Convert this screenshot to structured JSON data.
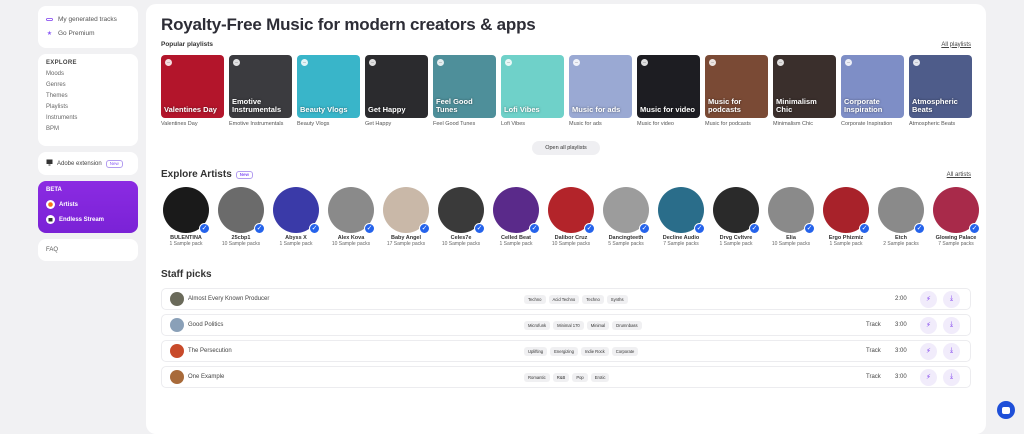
{
  "sidebar": {
    "generated": "My generated tracks",
    "premium": "Go Premium",
    "explore_title": "EXPLORE",
    "explore_items": [
      "Moods",
      "Genres",
      "Themes",
      "Playlists",
      "Instruments",
      "BPM"
    ],
    "extension": "Adobe extension",
    "new_badge": "New",
    "beta_title": "BETA",
    "beta_items": [
      "Artists",
      "Endless Stream"
    ],
    "faq": "FAQ"
  },
  "main": {
    "title": "Royalty-Free Music for modern creators & apps",
    "popular_title": "Popular playlists",
    "all_playlists": "All playlists",
    "open_all": "Open all playlists",
    "playlists": [
      {
        "label": "Valentines Day",
        "caption": "Valentines Day",
        "color": "#b3152b"
      },
      {
        "label": "Emotive Instrumentals",
        "caption": "Emotive Instrumentals",
        "color": "#3b3b3f"
      },
      {
        "label": "Beauty Vlogs",
        "caption": "Beauty Vlogs",
        "color": "#39b5c9"
      },
      {
        "label": "Get Happy",
        "caption": "Get Happy",
        "color": "#2b2b2e"
      },
      {
        "label": "Feel Good Tunes",
        "caption": "Feel Good Tunes",
        "color": "#4e8f9a"
      },
      {
        "label": "Lofi Vibes",
        "caption": "Lofi Vibes",
        "color": "#6fd1c9"
      },
      {
        "label": "Music for ads",
        "caption": "Music for ads",
        "color": "#9aa9d3"
      },
      {
        "label": "Music for video",
        "caption": "Music for video",
        "color": "#1d1d22"
      },
      {
        "label": "Music for podcasts",
        "caption": "Music for podcasts",
        "color": "#7a4a35"
      },
      {
        "label": "Minimalism Chic",
        "caption": "Minimalism Chic",
        "color": "#3a2f2c"
      },
      {
        "label": "Corporate Inspiration",
        "caption": "Corporate Inspiration",
        "color": "#7e8ec6"
      },
      {
        "label": "Atmospheric Beats",
        "caption": "Atmospheric Beats",
        "color": "#4e5c8a"
      }
    ],
    "artists_title": "Explore Artists",
    "artists_badge": "New",
    "all_artists": "All artists",
    "artists": [
      {
        "name": "BULENTINA",
        "packs": "1 Sample pack",
        "color": "#1a1a1a"
      },
      {
        "name": "25cbp1",
        "packs": "10 Sample packs",
        "color": "#6b6b6b"
      },
      {
        "name": "Abyss X",
        "packs": "1 Sample pack",
        "color": "#3a3aa8"
      },
      {
        "name": "Alex Kova",
        "packs": "10 Sample packs",
        "color": "#8a8a8a"
      },
      {
        "name": "Baby Angel",
        "packs": "17 Sample packs",
        "color": "#c9b8a8"
      },
      {
        "name": "Celes7e",
        "packs": "10 Sample packs",
        "color": "#3a3a3a"
      },
      {
        "name": "Celled Beat",
        "packs": "1 Sample pack",
        "color": "#5a2a8a"
      },
      {
        "name": "Dalibor Cruz",
        "packs": "10 Sample packs",
        "color": "#b3242a"
      },
      {
        "name": "Dancingteeth",
        "packs": "5 Sample packs",
        "color": "#9c9c9c"
      },
      {
        "name": "Decline Audio",
        "packs": "7 Sample packs",
        "color": "#2a6d8a"
      },
      {
        "name": "Drvg Cvltvre",
        "packs": "1 Sample pack",
        "color": "#2a2a2a"
      },
      {
        "name": "Elia",
        "packs": "10 Sample packs",
        "color": "#8a8a8a"
      },
      {
        "name": "Ergo Phizmiz",
        "packs": "1 Sample pack",
        "color": "#a8222a"
      },
      {
        "name": "Etch",
        "packs": "2 Sample packs",
        "color": "#8a8a8a"
      },
      {
        "name": "Glowing Palace",
        "packs": "7 Sample packs",
        "color": "#a82a4a"
      }
    ],
    "staff_title": "Staff picks",
    "tracks": [
      {
        "name": "Almost Every Known Producer",
        "tags": [
          "Techno",
          "Acid Techno",
          "Techno",
          "Synths"
        ],
        "type": "",
        "duration": "2:00",
        "color": "#6a6a5a"
      },
      {
        "name": "Good Politics",
        "tags": [
          "Microfunk",
          "Minimal 170",
          "Minimal",
          "Drumnbass"
        ],
        "type": "Track",
        "duration": "3:00",
        "color": "#8aa0b8"
      },
      {
        "name": "The Persecution",
        "tags": [
          "Uplifting",
          "Energizing",
          "Indie Rock",
          "Corporate"
        ],
        "type": "Track",
        "duration": "3:00",
        "color": "#c84a2a"
      },
      {
        "name": "One Example",
        "tags": [
          "Romantic",
          "R&B",
          "Pop",
          "Erotic"
        ],
        "type": "Track",
        "duration": "3:00",
        "color": "#a86a3a"
      }
    ]
  }
}
